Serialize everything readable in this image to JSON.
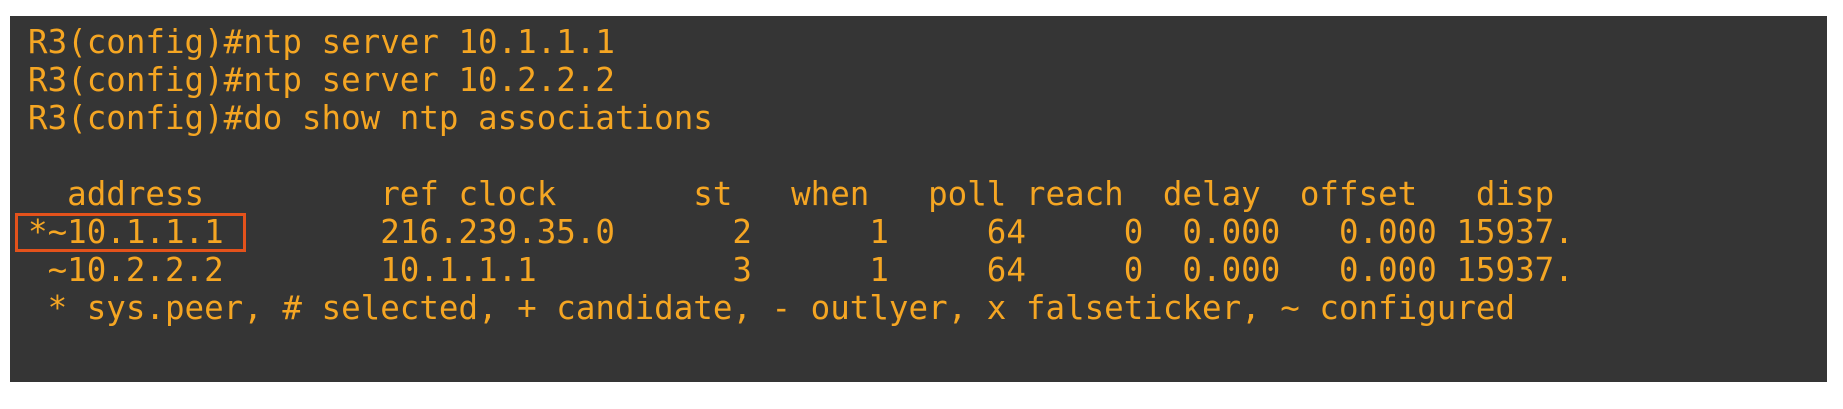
{
  "terminal": {
    "command_lines": [
      "R3(config)#ntp server 10.1.1.1",
      "R3(config)#ntp server 10.2.2.2",
      "R3(config)#do show ntp associations"
    ],
    "table_header": "  address         ref clock       st   when   poll reach  delay  offset   disp",
    "table_rows": [
      "*~10.1.1.1        216.239.35.0      2      1     64     0  0.000   0.000 15937.",
      " ~10.2.2.2        10.1.1.1          3      1     64     0  0.000   0.000 15937."
    ],
    "legend": " * sys.peer, # selected, + candidate, - outlyer, x falseticker, ~ configured",
    "colors": {
      "background": "#353535",
      "text": "#f5a623",
      "highlight": "#e4521b"
    }
  }
}
